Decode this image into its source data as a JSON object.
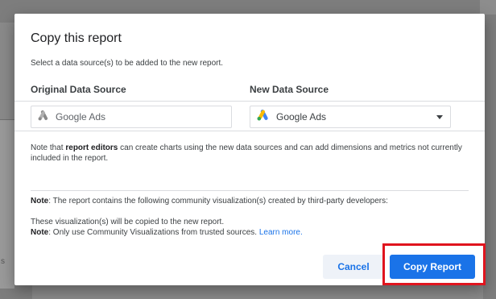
{
  "dialog": {
    "title": "Copy this report",
    "subtitle": "Select a data source(s) to be added to the new report.",
    "original_header": "Original Data Source",
    "new_header": "New Data Source",
    "original_source": {
      "label": "Google Ads",
      "icon": "google-ads-grey-icon"
    },
    "new_source": {
      "label": "Google Ads",
      "icon": "google-ads-icon"
    },
    "note1": {
      "prefix": "Note that ",
      "bold": "report editors",
      "suffix": " can create charts using the new data sources and can add dimensions and metrics not currently included in the report."
    },
    "note2": {
      "bold": "Note",
      "text": ": The report contains the following community visualization(s) created by third-party developers:"
    },
    "note3": {
      "line1": "These visualization(s) will be copied to the new report.",
      "bold": "Note",
      "text": ": Only use Community Visualizations from trusted sources. ",
      "link": "Learn more."
    },
    "cancel_label": "Cancel",
    "copy_label": "Copy Report"
  },
  "colors": {
    "accent": "#1a73e8",
    "highlight": "#e0141e",
    "ads_yellow": "#fbbc04",
    "ads_green": "#34a853"
  }
}
